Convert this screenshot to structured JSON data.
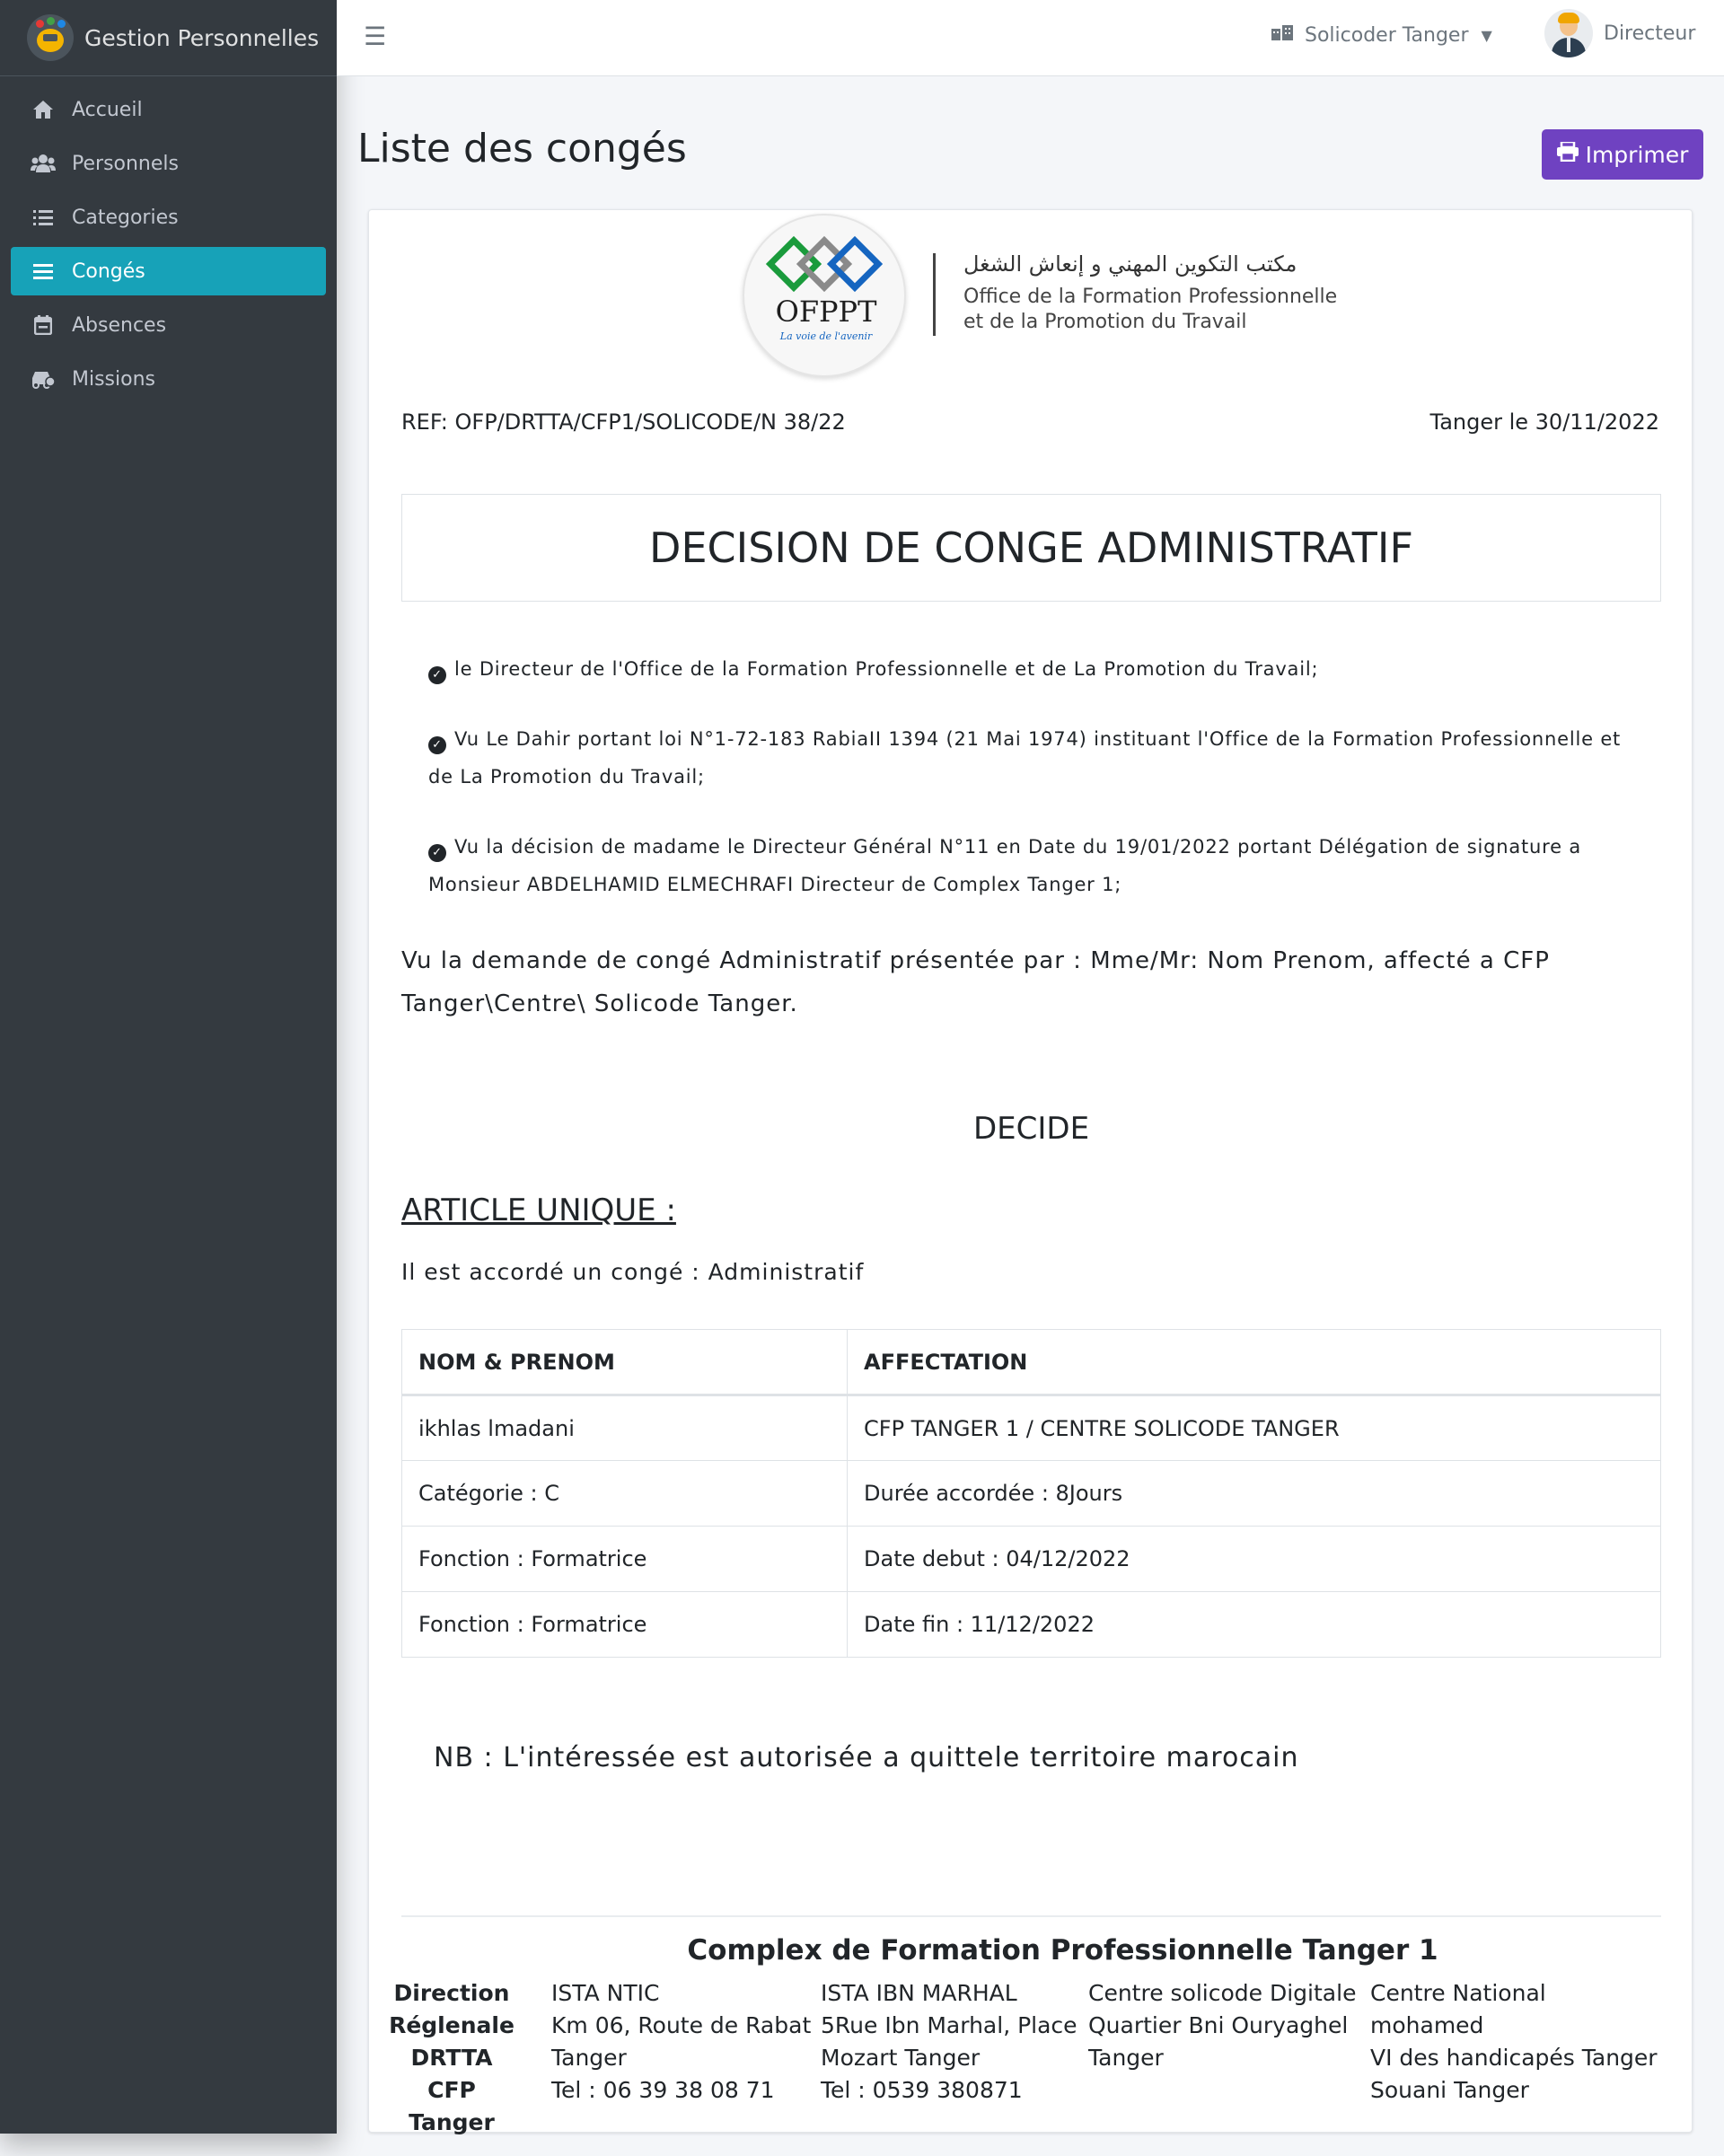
{
  "app": {
    "brand": "Gestion Personnelles",
    "nav": [
      {
        "label": "Accueil",
        "icon": "home-icon"
      },
      {
        "label": "Personnels",
        "icon": "users-icon"
      },
      {
        "label": "Categories",
        "icon": "list-icon"
      },
      {
        "label": "Congés",
        "icon": "bars-icon",
        "active": true
      },
      {
        "label": "Absences",
        "icon": "calendar-icon"
      },
      {
        "label": "Missions",
        "icon": "car-icon"
      }
    ]
  },
  "topbar": {
    "center": "Solicoder Tanger",
    "user": "Directeur"
  },
  "page": {
    "title": "Liste des congés",
    "print_label": "Imprimer"
  },
  "letter": {
    "logo_word": "OFPPT",
    "logo_tagline": "La voie de l'avenir",
    "org_arabic": "مكتب التكوين المهني و إنعاش الشغل",
    "org_fr_line1": "Office de la Formation Professionnelle",
    "org_fr_line2": "et de la Promotion du Travail",
    "ref": "REF: OFP/DRTTA/CFP1/SOLICODE/N 38/22",
    "date": "Tanger le 30/11/2022",
    "title": "DECISION DE CONGE ADMINISTRATIF",
    "considerations": [
      "le Directeur de l'Office de la Formation Professionnelle et de La Promotion du Travail;",
      "Vu Le Dahir portant loi N°1-72-183 RabiaII 1394 (21 Mai 1974) instituant l'Office de la Formation Professionnelle et de La Promotion du Travail;",
      "Vu la décision de madame le Directeur Général N°11 en Date du 19/01/2022 portant Délégation de signature a Monsieur ABDELHAMID ELMECHRAFI Directeur de Complex Tanger 1;"
    ],
    "demande": "Vu la demande de congé Administratif présentée par : Mme/Mr: Nom Prenom, affecté a CFP Tanger\\Centre\\ Solicode Tanger.",
    "decide": "DECIDE",
    "article": "ARTICLE UNIQUE :",
    "accord": "Il est accordé un congé : Administratif",
    "table": {
      "headers": [
        "NOM & PRENOM",
        "AFFECTATION"
      ],
      "rows": [
        [
          "ikhlas lmadani",
          "CFP TANGER 1 / CENTRE SOLICODE TANGER"
        ],
        [
          "Catégorie : C",
          "Durée accordée : 8Jours"
        ],
        [
          "Fonction : Formatrice",
          "Date debut : 04/12/2022"
        ],
        [
          "Fonction : Formatrice",
          "Date fin : 11/12/2022"
        ]
      ]
    },
    "nb": "NB : L'intéressée est autorisée a quittele territoire marocain",
    "footer": {
      "title": "Complex de Formation Professionnelle Tanger 1",
      "direction": [
        "Direction",
        "Réglenale",
        "DRTTA",
        "CFP Tanger"
      ],
      "col_a": [
        "ISTA NTIC",
        "Km 06, Route de Rabat",
        "Tanger",
        "Tel : 06 39 38 08 71"
      ],
      "col_b": [
        "ISTA IBN MARHAL",
        "5Rue Ibn Marhal, Place",
        "Mozart Tanger",
        "Tel : 0539 380871"
      ],
      "col_c": [
        "Centre solicode Digitale",
        "Quartier Bni Ouryaghel",
        "Tanger"
      ],
      "col_d": [
        "Centre National mohamed",
        "VI des handicapés Tanger",
        "Souani Tanger"
      ]
    }
  },
  "colors": {
    "sidebar_bg": "#343a40",
    "active_nav": "#17a2b8",
    "print_button": "#6f42c1"
  }
}
